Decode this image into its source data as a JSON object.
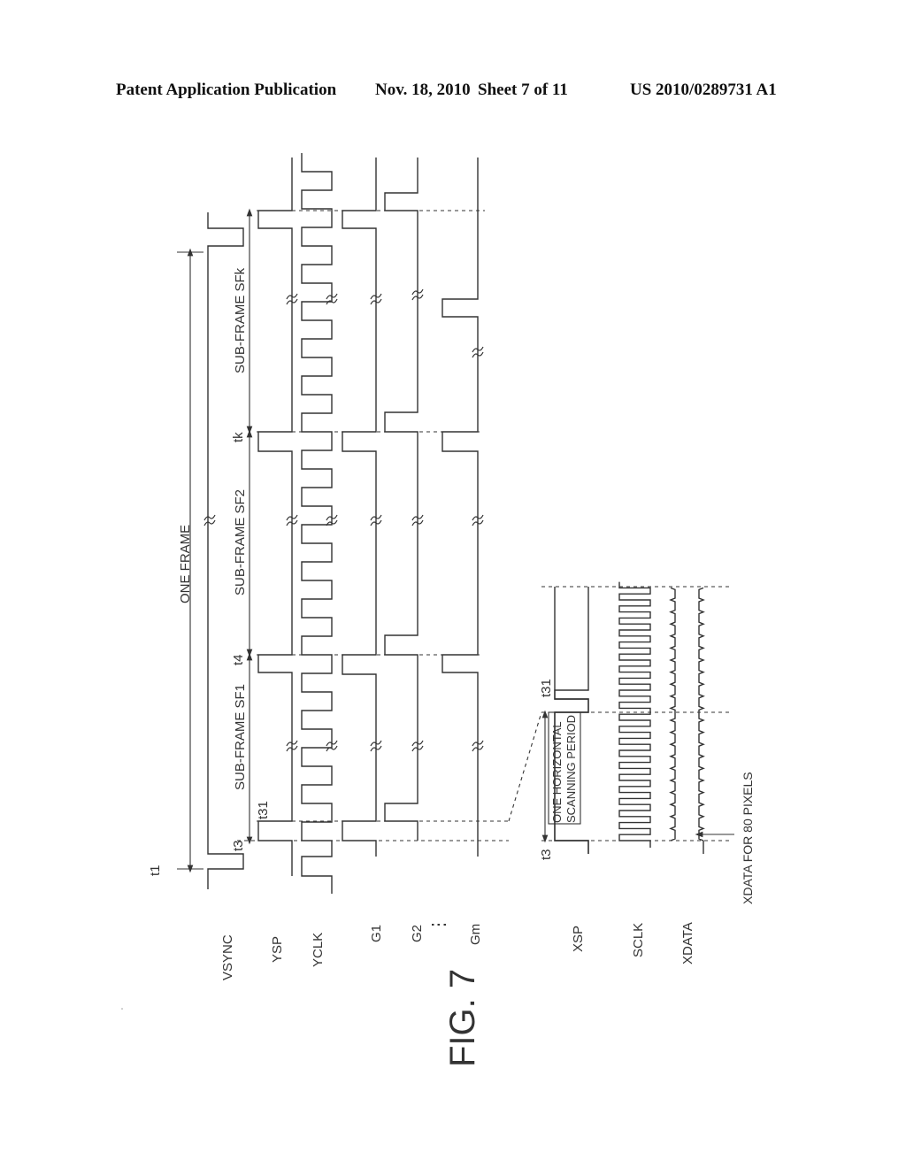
{
  "header": {
    "publication": "Patent Application Publication",
    "date": "Nov. 18, 2010",
    "sheet": "Sheet 7 of 11",
    "number": "US 2010/0289731 A1"
  },
  "figure": {
    "label": "FIG. 7",
    "signals": [
      "VSYNC",
      "YSP",
      "YCLK",
      "G1",
      "G2",
      "Gm",
      "XSP",
      "SCLK",
      "XDATA"
    ],
    "ellipsis": "⋮",
    "time_markers": [
      "t1",
      "t3",
      "t31",
      "t4",
      "tk"
    ],
    "detail_time_markers": [
      "t3",
      "t31"
    ],
    "periods": {
      "one_frame": "ONE FRAME",
      "sf1": "SUB-FRAME SF1",
      "sf2": "SUB-FRAME SF2",
      "sfk": "SUB-FRAME SFk",
      "horizontal_line1": "ONE HORIZONTAL",
      "horizontal_line2": "SCANNING PERIOD",
      "xdata_note": "XDATA FOR 80 PIXELS"
    }
  }
}
